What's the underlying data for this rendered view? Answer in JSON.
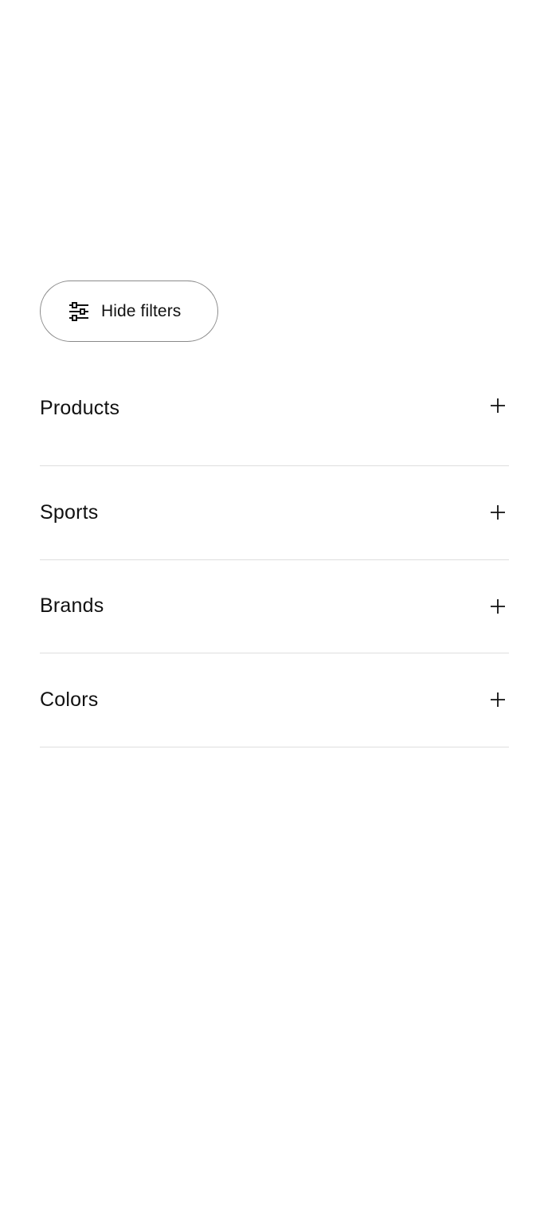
{
  "filters": {
    "toggle_label": "Hide filters",
    "toggle_icon": "sliders-icon",
    "sections": [
      {
        "label": "Products",
        "icon": "plus-icon"
      },
      {
        "label": "Sports",
        "icon": "plus-icon"
      },
      {
        "label": "Brands",
        "icon": "plus-icon"
      },
      {
        "label": "Colors",
        "icon": "plus-icon"
      }
    ]
  },
  "colors": {
    "text": "#111111",
    "button_border": "#8a8a8a",
    "divider": "#dedede",
    "background": "#ffffff"
  }
}
